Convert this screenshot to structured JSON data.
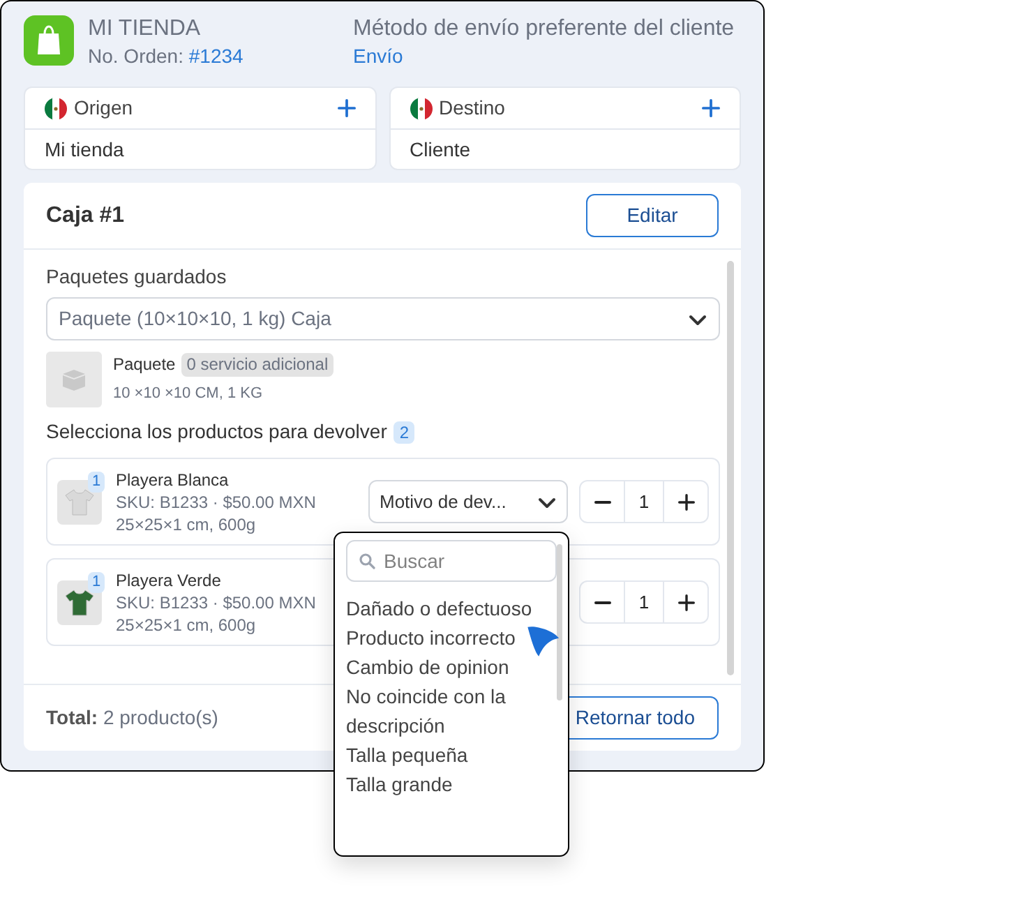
{
  "header": {
    "store": "MI TIENDA",
    "order_label": "No. Orden:",
    "order_number": "#1234",
    "method_title": "Método de envío preferente del cliente",
    "method_value": "Envío"
  },
  "locations": [
    {
      "label": "Origen",
      "value": "Mi tienda"
    },
    {
      "label": "Destino",
      "value": "Cliente"
    }
  ],
  "box": {
    "title": "Caja #1",
    "edit_button": "Editar",
    "saved_label": "Paquetes guardados",
    "package_select": "Paquete (10×10×10, 1 kg) Caja",
    "package_name": "Paquete",
    "package_tag": "0 servicio adicional",
    "package_dims": "10 ×10 ×10 CM, 1 KG",
    "products_label": "Selecciona los productos para devolver",
    "products_count": "2"
  },
  "products": [
    {
      "name": "Playera Blanca",
      "sku": "SKU: B1233 · $50.00 MXN",
      "dims": "25×25×1 cm, 600g",
      "badge": "1",
      "color": "#d9d9d9",
      "reason": "Motivo de dev...",
      "quantity": "1"
    },
    {
      "name": "Playera Verde",
      "sku": "SKU: B1233 · $50.00 MXN",
      "dims": "25×25×1 cm, 600g",
      "badge": "1",
      "color": "#2f6b35",
      "quantity": "1"
    }
  ],
  "footer": {
    "total_label": "Total:",
    "total_value": "2 producto(s)",
    "return_all": "Retornar todo"
  },
  "dropdown": {
    "placeholder": "Buscar",
    "options": [
      "Dañado o defectuoso",
      "Producto incorrecto",
      "Cambio de opinion",
      "No coincide con la descripción",
      "Talla pequeña",
      "Talla grande"
    ]
  }
}
